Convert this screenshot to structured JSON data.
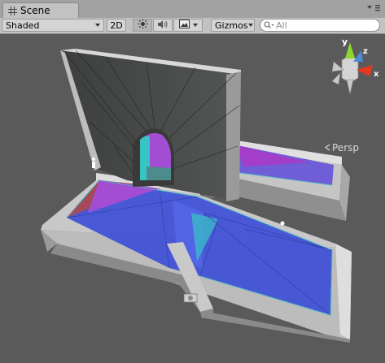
{
  "tab": {
    "label": "Scene",
    "icon": "scene-grid-icon"
  },
  "window_menu_icon": "window-menu-icon",
  "toolbar": {
    "shading_mode": "Shaded",
    "mode_2d_label": "2D",
    "lighting_icon": "sun-icon",
    "audio_icon": "speaker-icon",
    "effects_icon": "image-icon",
    "gizmos_label": "Gizmos",
    "search_placeholder": "All"
  },
  "gizmo": {
    "x_label": "x",
    "y_label": "y",
    "z_label": "z",
    "projection_label": "Persp"
  },
  "colors": {
    "viewport_bg": "#5a5a5a",
    "axis_x": "#e8381c",
    "axis_y": "#8fd62f",
    "axis_z": "#4a8cd8",
    "navmesh_blue": "#3e4fd6",
    "navmesh_magenta": "#a34ed2",
    "navmesh_red": "#a44a5a",
    "navmesh_cyan": "#39c4c4"
  }
}
